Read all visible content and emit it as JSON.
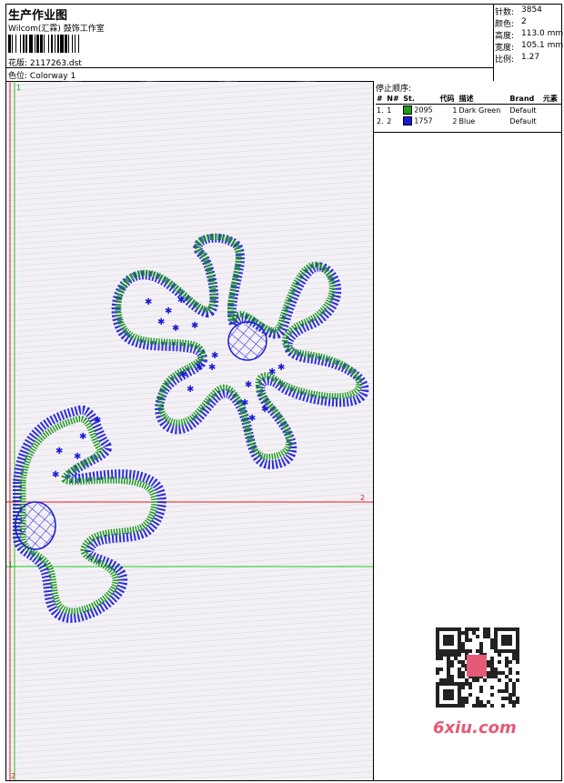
{
  "header": {
    "title": "生产作业图",
    "company": "Wilcom(汇霖) 鼓饰工作室",
    "design_label": "花版:",
    "design_file": "2117263.dst",
    "colorway_label": "色位:",
    "colorway": "Colorway 1"
  },
  "stats": [
    {
      "label": "针数:",
      "value": "3854"
    },
    {
      "label": "颜色:",
      "value": "2"
    },
    {
      "label": "高度:",
      "value": "113.0 mm"
    },
    {
      "label": "宽度:",
      "value": "105.1 mm"
    },
    {
      "label": "比例:",
      "value": "1.27"
    }
  ],
  "stop_sequence": {
    "title": "停止顺序:",
    "columns": [
      "#",
      "N#",
      "St.",
      "代码",
      "描述",
      "Brand",
      "元素"
    ],
    "rows": [
      {
        "num": "1.",
        "n": "1",
        "color": "#1f9a1f",
        "st": "2095",
        "code": "1",
        "desc": "Dark Green",
        "brand": "Default"
      },
      {
        "num": "2.",
        "n": "2",
        "color": "#1a1ad6",
        "st": "1757",
        "code": "2",
        "desc": "Blue",
        "brand": "Default"
      }
    ]
  },
  "markers": {
    "green_label": "1",
    "red_label": "2"
  },
  "watermark": {
    "site": "6xiu.com"
  },
  "colors": {
    "green": "#1f9a1f",
    "blue": "#1a1ad6",
    "guide_red": "#e02020",
    "guide_green": "#22cc22"
  }
}
